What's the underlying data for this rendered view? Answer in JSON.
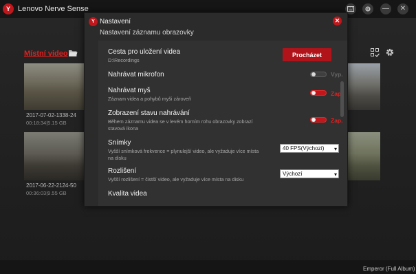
{
  "app": {
    "title": "Lenovo Nerve Sense",
    "logo_text": "Y"
  },
  "window_controls": {
    "keyboard_icon": "keyboard-icon",
    "settings_icon": "settings-icon",
    "minimize_glyph": "—",
    "close_glyph": "✕"
  },
  "library": {
    "local_video_label": "Místní video",
    "videos": [
      {
        "title": "2017-07-02-1338-24",
        "meta": "00:18:34|5.15 GB"
      },
      {
        "title": "2017-06-22-2124-50",
        "meta": "00:36:03|9.55 GB"
      }
    ]
  },
  "footer": {
    "text": "Emperor (Full Album)"
  },
  "dialog": {
    "title": "Nastavení",
    "close_glyph": "✕",
    "subtitle": "Nastavení záznamu obrazovky",
    "save_path": {
      "title": "Cesta pro uložení videa",
      "value": "D:\\Recordings",
      "button_label": "Procházet"
    },
    "microphone": {
      "title": "Nahrávat mikrofon",
      "state_label": "Vyp.",
      "enabled": false
    },
    "mouse": {
      "title": "Nahrávat myš",
      "desc": "Záznam videa a pohybů myši zároveň",
      "state_label": "Zap.",
      "enabled": true
    },
    "status_display": {
      "title": "Zobrazení stavu nahrávání",
      "desc": "Během záznamu videa se v levém horním rohu obrazovky zobrazí stavová ikona",
      "state_label": "Zap.",
      "enabled": true
    },
    "framerate": {
      "title": "Snímky",
      "desc": "Vyšší snímková frekvence = plynulejší video, ale vyžaduje více místa na disku",
      "selected": "40 FPS(Výchozí)"
    },
    "resolution": {
      "title": "Rozlišení",
      "desc": "Vyšší rozlišení = čistší video, ale vyžaduje více místa na disku",
      "selected": "Výchozí"
    },
    "quality": {
      "title": "Kvalita videa"
    }
  },
  "colors": {
    "accent": "#c0171c",
    "background": "#1e1e1e",
    "dialog_bg": "#2b2b2b"
  }
}
